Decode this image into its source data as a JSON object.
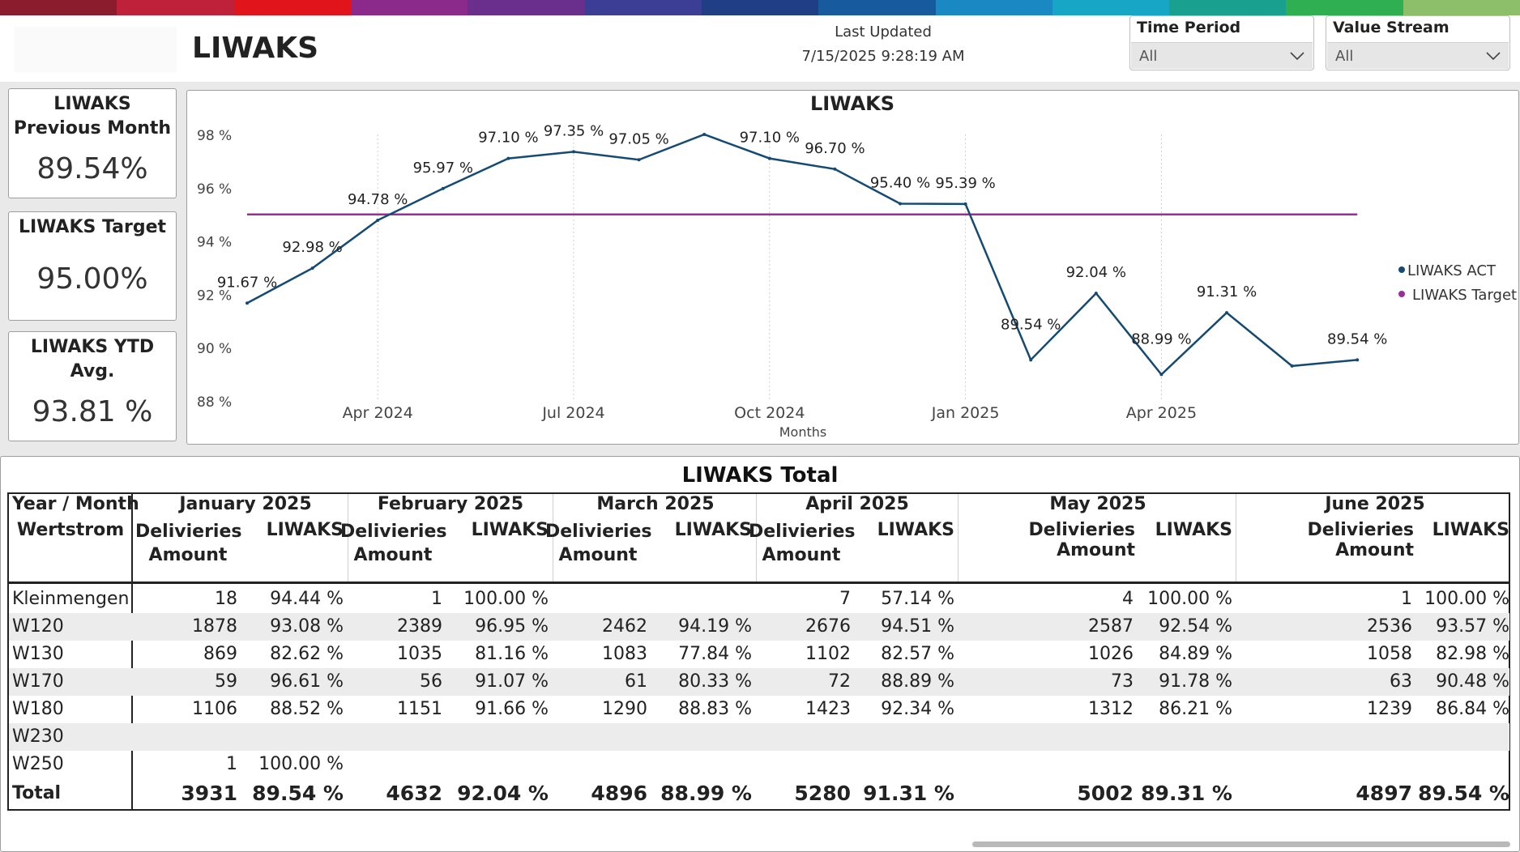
{
  "brand_colors": [
    "#8a1c2d",
    "#c0213a",
    "#e1141b",
    "#8b2a8a",
    "#6a2f8c",
    "#3b3e94",
    "#1f3e86",
    "#185a9e",
    "#1a88c3",
    "#18a6c7",
    "#19a08e",
    "#2fae52",
    "#8dbf6b"
  ],
  "header": {
    "title": "LIWAKS",
    "last_updated_label": "Last Updated",
    "last_updated_value": "7/15/2025 9:28:19 AM"
  },
  "filters": {
    "time_period": {
      "label": "Time Period",
      "value": "All"
    },
    "value_stream": {
      "label": "Value Stream",
      "value": "All"
    }
  },
  "kpis": {
    "previous_month": {
      "title_line1": "LIWAKS",
      "title_line2": "Previous Month",
      "value": "89.54%"
    },
    "target": {
      "title": "LIWAKS Target",
      "value": "95.00%"
    },
    "ytd": {
      "title_line1": "LIWAKS YTD",
      "title_line2": "Avg.",
      "value": "93.81 %"
    }
  },
  "chart_data": {
    "type": "line",
    "title": "LIWAKS",
    "xlabel": "Months",
    "ylabel": "",
    "ylim": [
      88,
      98
    ],
    "y_ticks": [
      "88 %",
      "90 %",
      "92 %",
      "94 %",
      "96 %",
      "98 %"
    ],
    "x_ticks": [
      "Apr 2024",
      "Jul 2024",
      "Oct 2024",
      "Jan 2025",
      "Apr 2025"
    ],
    "x": [
      "Feb 2024",
      "Mar 2024",
      "Apr 2024",
      "May 2024",
      "Jun 2024",
      "Jul 2024",
      "Aug 2024",
      "Sep 2024",
      "Oct 2024",
      "Nov 2024",
      "Dec 2024",
      "Jan 2025",
      "Feb 2025",
      "Mar 2025",
      "Apr 2025",
      "May 2025",
      "Jun 2025",
      "Jul 2025"
    ],
    "series": [
      {
        "name": "LIWAKS ACT",
        "color": "#154a73",
        "values": [
          91.67,
          92.98,
          94.78,
          95.97,
          97.1,
          97.35,
          97.05,
          98.0,
          97.1,
          96.7,
          95.4,
          95.39,
          89.54,
          92.04,
          88.99,
          91.31,
          89.31,
          89.54
        ],
        "labels": [
          "91.67 %",
          "92.98 %",
          "94.78 %",
          "95.97 %",
          "97.10 %",
          "97.35 %",
          "97.05 %",
          "",
          "97.10 %",
          "96.70 %",
          "95.40 %",
          "95.39 %",
          "89.54 %",
          "92.04 %",
          "88.99 %",
          "91.31 %",
          "",
          "89.54 %"
        ]
      },
      {
        "name": "LIWAKS Target",
        "color": "#9b2c9b",
        "values": [
          95,
          95,
          95,
          95,
          95,
          95,
          95,
          95,
          95,
          95,
          95,
          95,
          95,
          95,
          95,
          95,
          95,
          95
        ]
      }
    ],
    "grid": false,
    "legend": "right"
  },
  "table": {
    "title": "LIWAKS Total",
    "corner_line1": "Year / Month",
    "corner_line2": "Wertstrom",
    "months": [
      {
        "name": "January 2025",
        "col_a": "Delivieries Amount",
        "col_b": "LIWAKS"
      },
      {
        "name": "February 2025",
        "col_a": "Delivieries Amount",
        "col_b": "LIWAKS"
      },
      {
        "name": "March 2025",
        "col_a": "Delivieries Amount",
        "col_b": "LIWAKS"
      },
      {
        "name": "April 2025",
        "col_a": "Delivieries Amount",
        "col_b": "LIWAKS"
      },
      {
        "name": "May 2025",
        "col_a": "Delivieries Amount",
        "col_b": "LIWAKS"
      },
      {
        "name": "June 2025",
        "col_a": "Delivieries Amount",
        "col_b": "LIWAKS"
      }
    ],
    "rows": [
      {
        "label": "Kleinmengen",
        "cells": [
          [
            "18",
            "94.44 %"
          ],
          [
            "1",
            "100.00 %"
          ],
          [
            "",
            ""
          ],
          [
            "7",
            "57.14 %"
          ],
          [
            "4",
            "100.00 %"
          ],
          [
            "1",
            "100.00 %"
          ]
        ]
      },
      {
        "label": "W120",
        "cells": [
          [
            "1878",
            "93.08 %"
          ],
          [
            "2389",
            "96.95 %"
          ],
          [
            "2462",
            "94.19 %"
          ],
          [
            "2676",
            "94.51 %"
          ],
          [
            "2587",
            "92.54 %"
          ],
          [
            "2536",
            "93.57 %"
          ]
        ]
      },
      {
        "label": "W130",
        "cells": [
          [
            "869",
            "82.62 %"
          ],
          [
            "1035",
            "81.16 %"
          ],
          [
            "1083",
            "77.84 %"
          ],
          [
            "1102",
            "82.57 %"
          ],
          [
            "1026",
            "84.89 %"
          ],
          [
            "1058",
            "82.98 %"
          ]
        ]
      },
      {
        "label": "W170",
        "cells": [
          [
            "59",
            "96.61 %"
          ],
          [
            "56",
            "91.07 %"
          ],
          [
            "61",
            "80.33 %"
          ],
          [
            "72",
            "88.89 %"
          ],
          [
            "73",
            "91.78 %"
          ],
          [
            "63",
            "90.48 %"
          ]
        ]
      },
      {
        "label": "W180",
        "cells": [
          [
            "1106",
            "88.52 %"
          ],
          [
            "1151",
            "91.66 %"
          ],
          [
            "1290",
            "88.83 %"
          ],
          [
            "1423",
            "92.34 %"
          ],
          [
            "1312",
            "86.21 %"
          ],
          [
            "1239",
            "86.84 %"
          ]
        ]
      },
      {
        "label": "W230",
        "cells": [
          [
            "",
            ""
          ],
          [
            "",
            ""
          ],
          [
            "",
            ""
          ],
          [
            "",
            ""
          ],
          [
            "",
            ""
          ],
          [
            "",
            ""
          ]
        ]
      },
      {
        "label": "W250",
        "cells": [
          [
            "1",
            "100.00 %"
          ],
          [
            "",
            ""
          ],
          [
            "",
            ""
          ],
          [
            "",
            ""
          ],
          [
            "",
            ""
          ],
          [
            "",
            ""
          ]
        ]
      }
    ],
    "total": {
      "label": "Total",
      "cells": [
        [
          "3931",
          "89.54 %"
        ],
        [
          "4632",
          "92.04 %"
        ],
        [
          "4896",
          "88.99 %"
        ],
        [
          "5280",
          "91.31 %"
        ],
        [
          "5002",
          "89.31 %"
        ],
        [
          "4897",
          "89.54 %"
        ]
      ]
    }
  }
}
